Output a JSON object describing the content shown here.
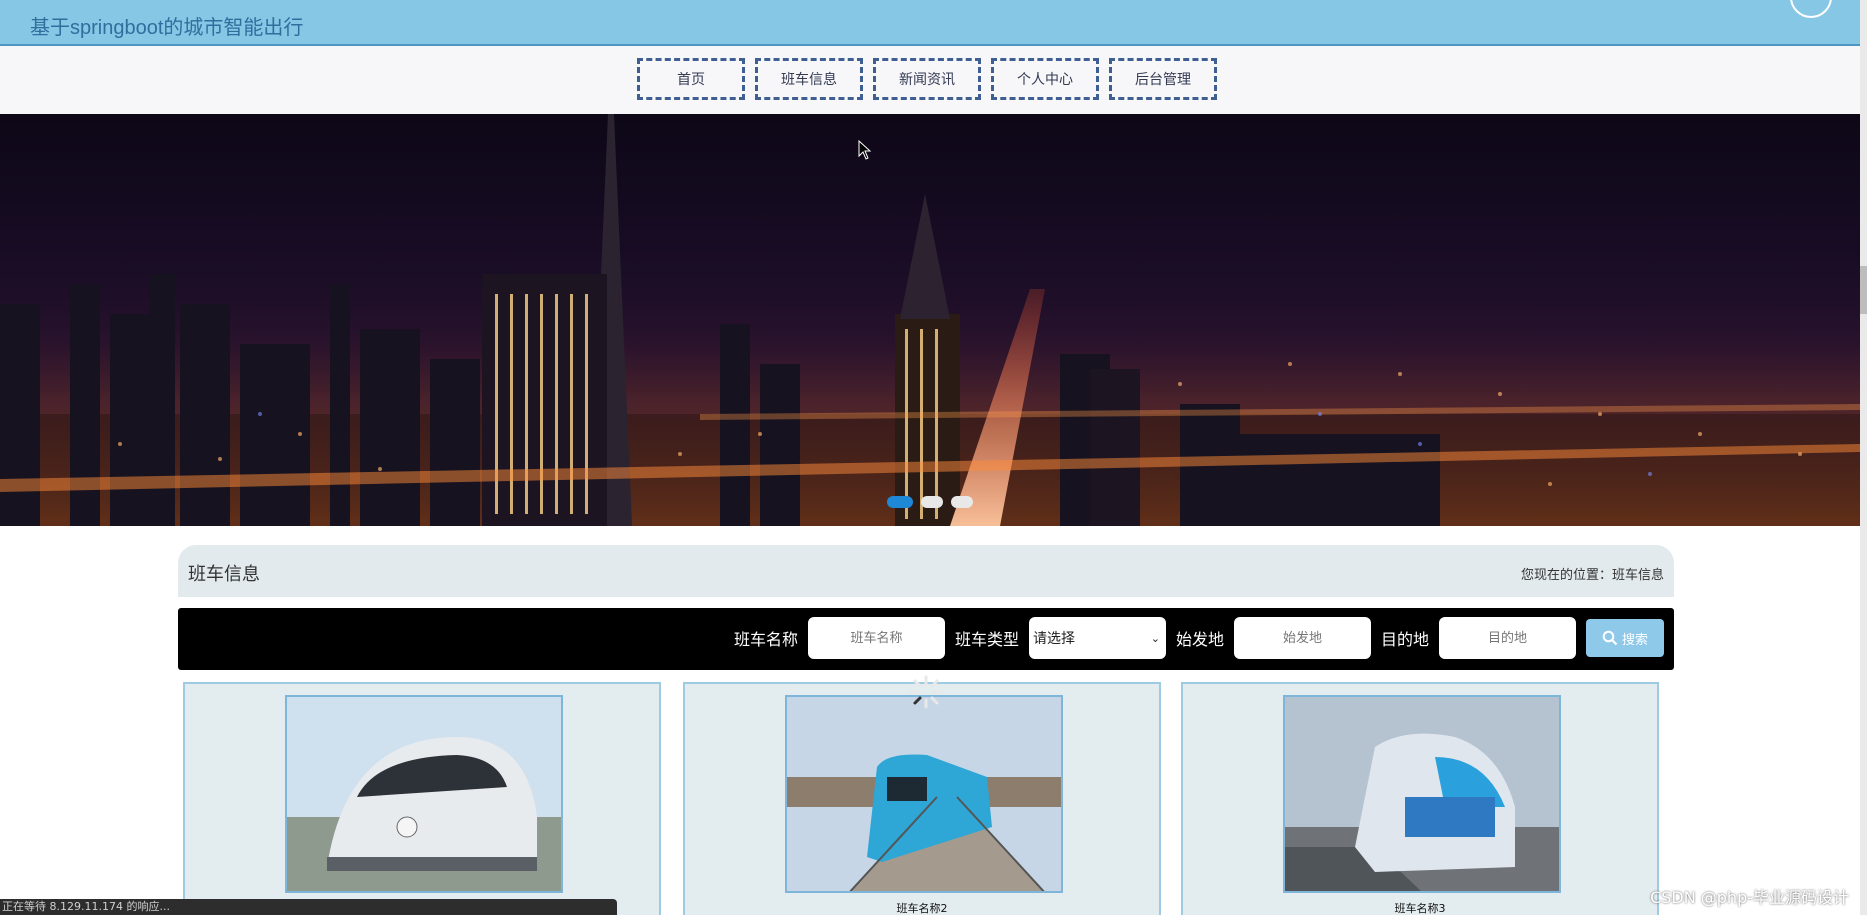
{
  "header": {
    "site_title": "基于springboot的城市智能出行"
  },
  "nav": {
    "items": [
      {
        "label": "首页"
      },
      {
        "label": "班车信息"
      },
      {
        "label": "新闻资讯"
      },
      {
        "label": "个人中心"
      },
      {
        "label": "后台管理"
      }
    ]
  },
  "banner": {
    "slide_count": 3,
    "active_slide": 1
  },
  "section": {
    "title": "班车信息",
    "breadcrumb": "您现在的位置：班车信息"
  },
  "search": {
    "name_label": "班车名称",
    "name_placeholder": "班车名称",
    "type_label": "班车类型",
    "type_selected": "请选择",
    "origin_label": "始发地",
    "origin_placeholder": "始发地",
    "dest_label": "目的地",
    "dest_placeholder": "目的地",
    "button_label": "搜索"
  },
  "cards": [
    {
      "name": ""
    },
    {
      "name": "班车名称2"
    },
    {
      "name": "班车名称3"
    }
  ],
  "watermark": "CSDN @php-毕业源码设计",
  "status_text": "正在等待 8.129.11.174 的响应...",
  "colors": {
    "header_bg": "#87c7e6",
    "nav_border": "#3f5f93",
    "search_bg": "#000000",
    "search_button": "#8fc9ea",
    "slide_dot_active": "#1e88d6"
  }
}
